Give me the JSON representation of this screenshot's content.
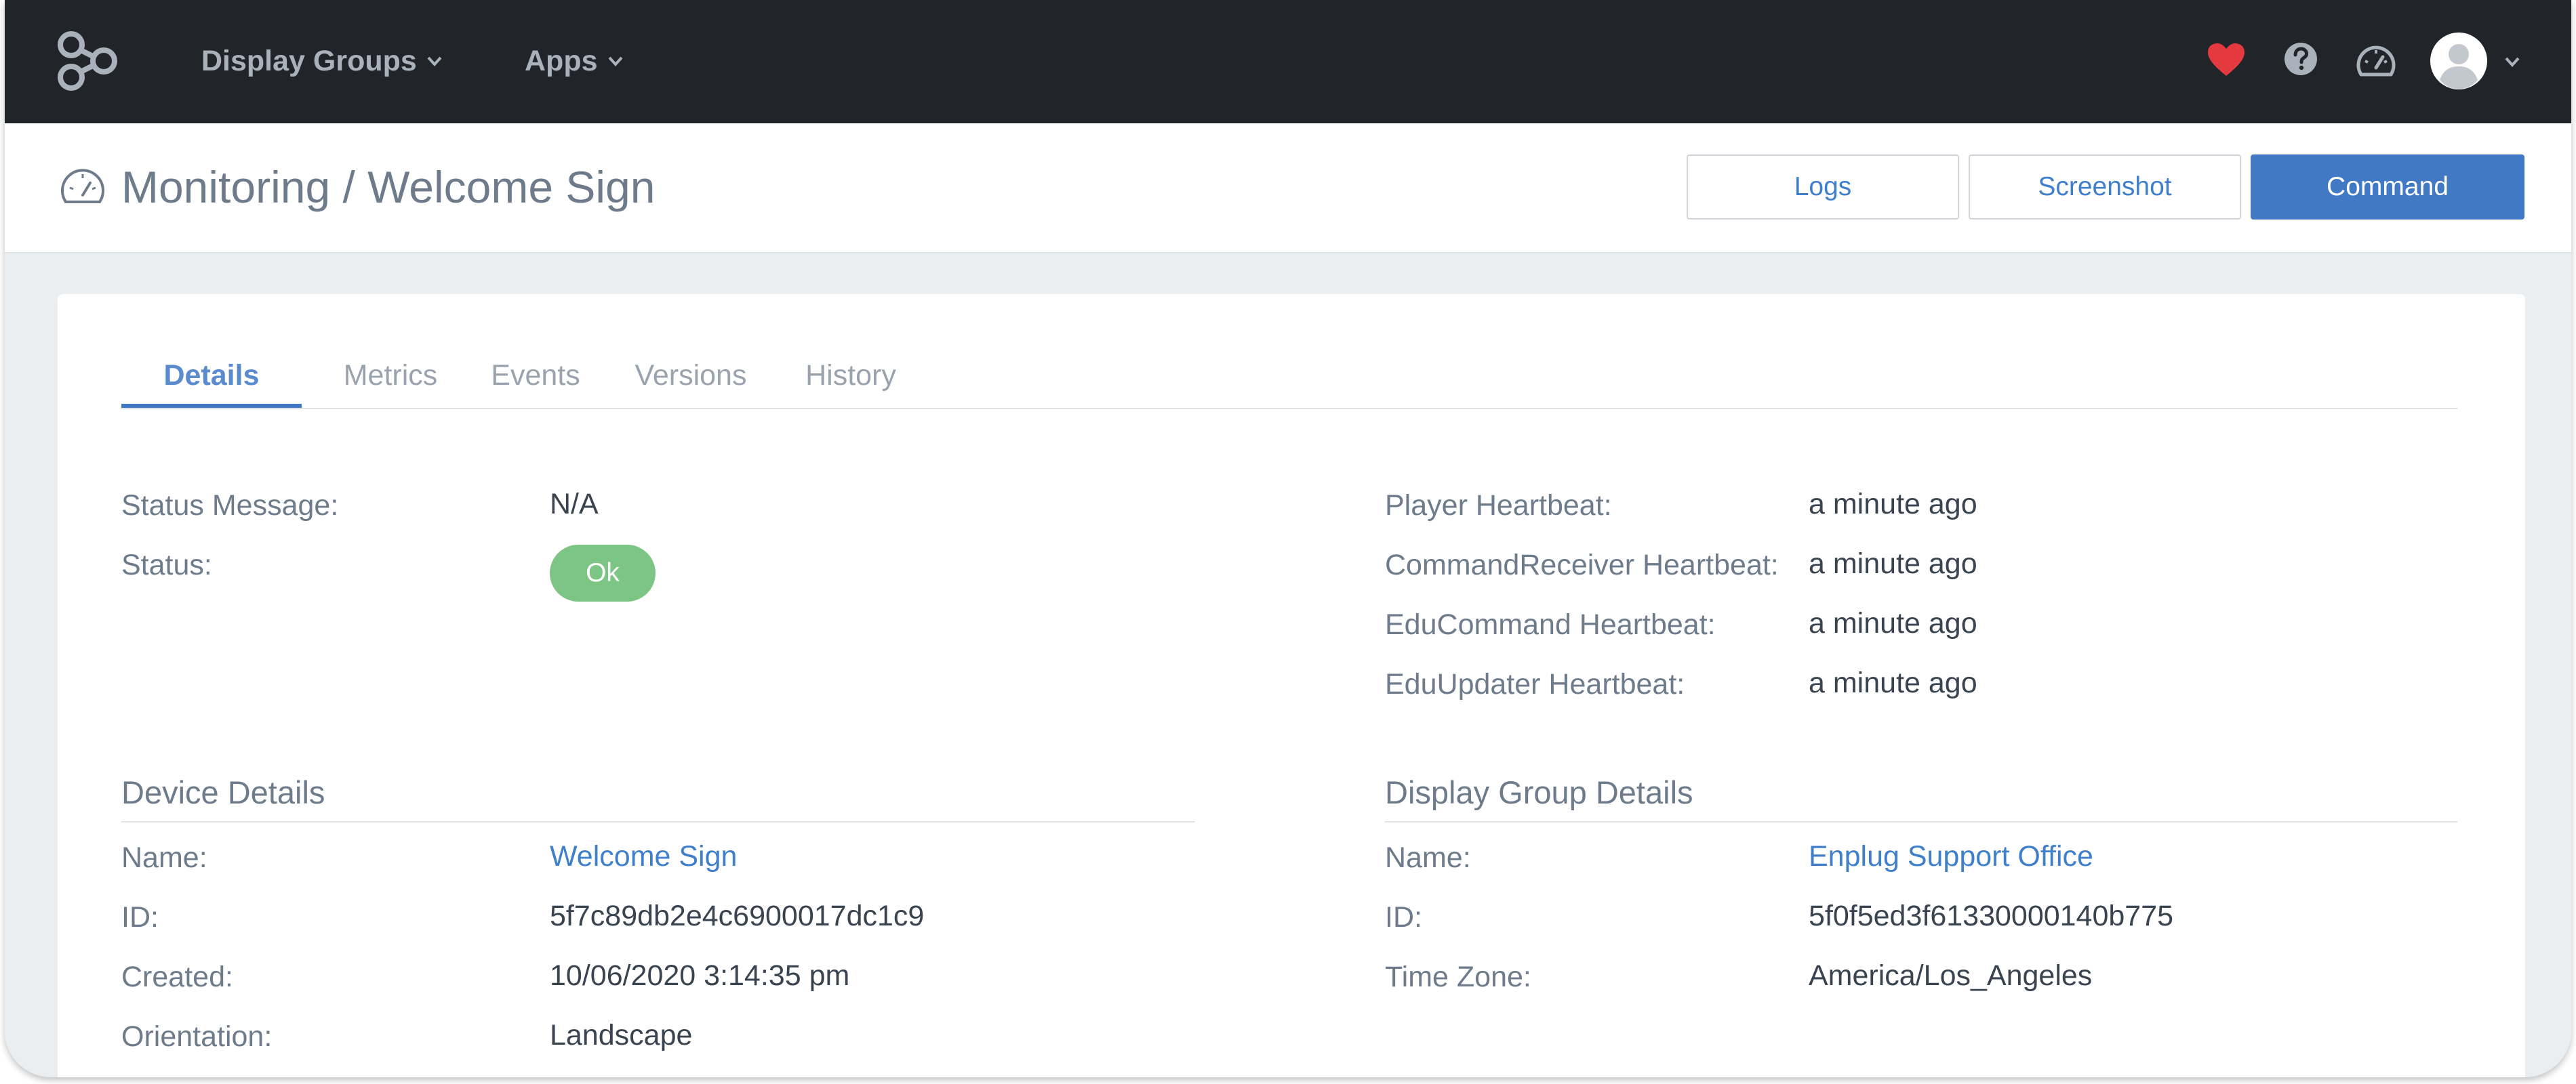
{
  "nav": {
    "display_groups_label": "Display Groups",
    "apps_label": "Apps",
    "heart_color": "#e53940",
    "icons": [
      "logo-icon",
      "heart-icon",
      "help-icon",
      "monitoring-icon",
      "avatar",
      "chevron-down-icon"
    ]
  },
  "header": {
    "title": "Monitoring / Welcome Sign",
    "buttons": {
      "logs": "Logs",
      "screenshot": "Screenshot",
      "command": "Command"
    }
  },
  "tabs": [
    {
      "label": "Details",
      "active": true
    },
    {
      "label": "Metrics",
      "active": false
    },
    {
      "label": "Events",
      "active": false
    },
    {
      "label": "Versions",
      "active": false
    },
    {
      "label": "History",
      "active": false
    }
  ],
  "status": {
    "message_label": "Status Message:",
    "message_value": "N/A",
    "status_label": "Status:",
    "status_value": "Ok"
  },
  "heartbeats": [
    {
      "label": "Player Heartbeat:",
      "value": "a minute ago"
    },
    {
      "label": "CommandReceiver Heartbeat:",
      "value": "a minute ago"
    },
    {
      "label": "EduCommand Heartbeat:",
      "value": "a minute ago"
    },
    {
      "label": "EduUpdater Heartbeat:",
      "value": "a minute ago"
    }
  ],
  "device": {
    "title": "Device Details",
    "rows": [
      {
        "label": "Name:",
        "value": "Welcome Sign"
      },
      {
        "label": "ID:",
        "value": "5f7c89db2e4c6900017dc1c9"
      },
      {
        "label": "Created:",
        "value": "10/06/2020 3:14:35 pm"
      },
      {
        "label": "Orientation:",
        "value": "Landscape"
      }
    ]
  },
  "display_group": {
    "title": "Display Group Details",
    "rows": [
      {
        "label": "Name:",
        "value": "Enplug Support Office"
      },
      {
        "label": "ID:",
        "value": "5f0f5ed3f61330000140b775"
      },
      {
        "label": "Time Zone:",
        "value": "America/Los_Angeles"
      }
    ]
  },
  "colors": {
    "navbar": "#212529",
    "accent": "#4279c4",
    "status_ok": "#7cc585"
  }
}
